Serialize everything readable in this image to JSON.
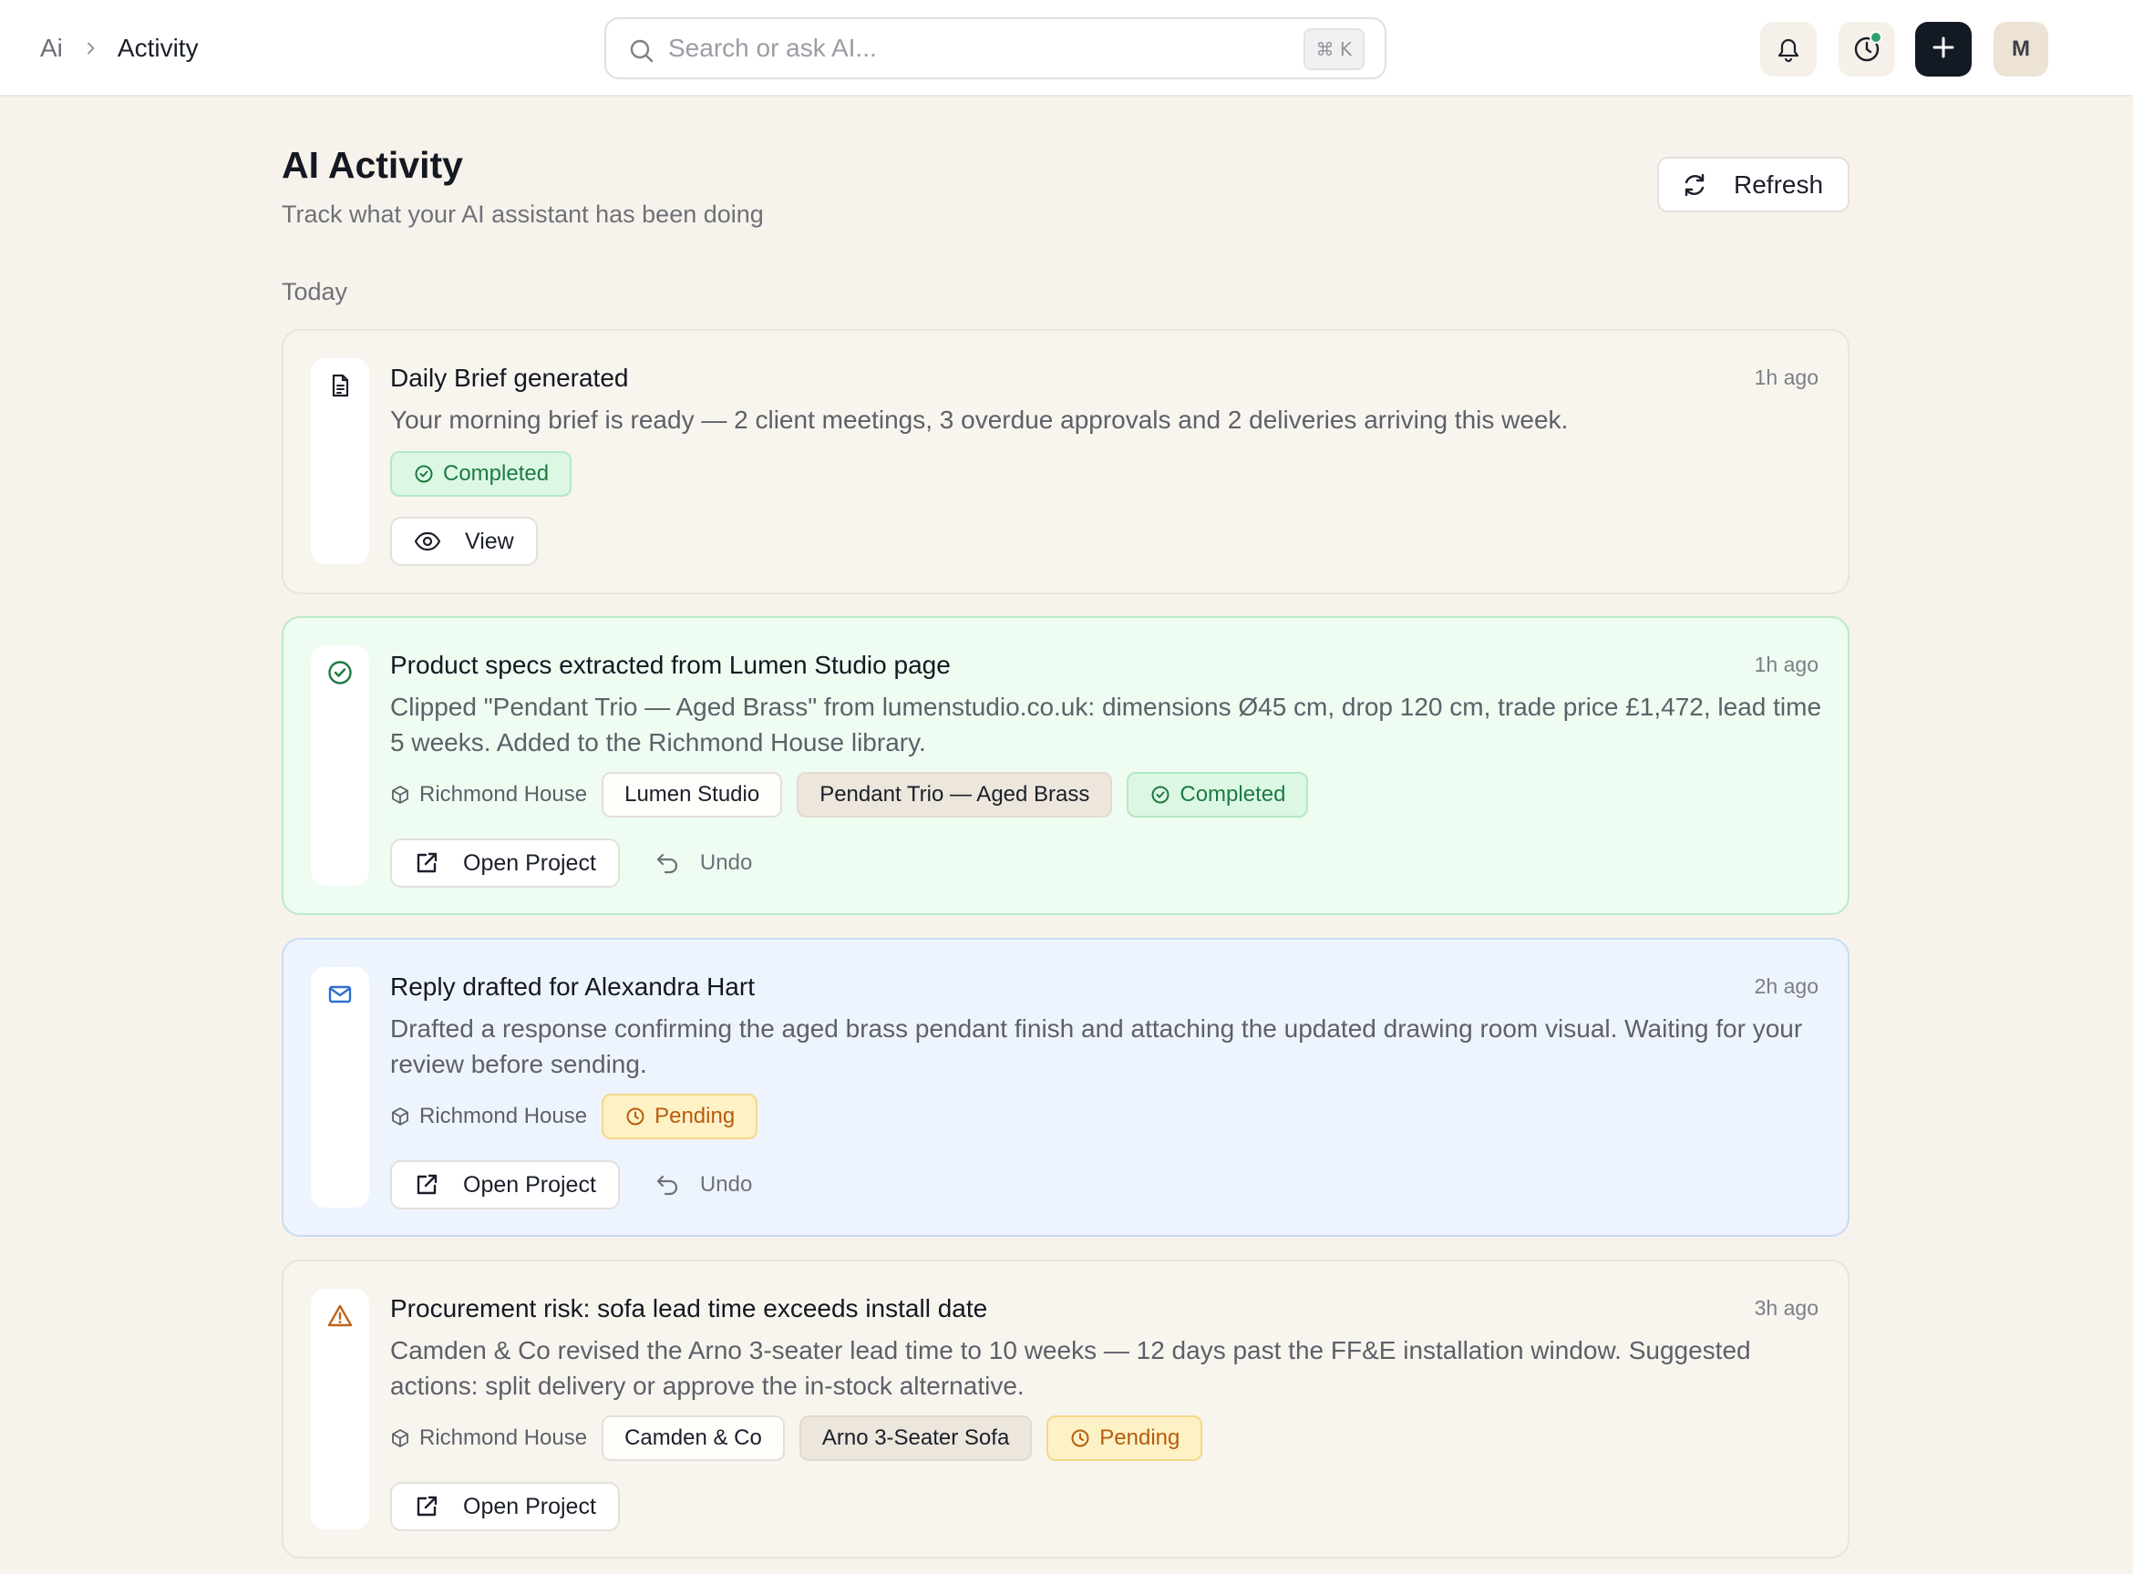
{
  "breadcrumb": {
    "root": "Ai",
    "current": "Activity"
  },
  "search": {
    "placeholder": "Search or ask AI...",
    "shortcut": "⌘ K"
  },
  "user": {
    "avatar_initial": "M"
  },
  "page": {
    "title": "AI Activity",
    "subtitle": "Track what your AI assistant has been doing",
    "refresh_label": "Refresh",
    "section_label": "Today"
  },
  "activities": [
    {
      "icon": "document-icon",
      "title": "Daily Brief generated",
      "time": "1h ago",
      "description": "Your morning brief is ready — 2 client meetings, 3 overdue approvals and 2 deliveries arriving this week.",
      "status": "Completed",
      "action_label": "View"
    },
    {
      "icon": "check-circle-icon",
      "title": "Product specs extracted from Lumen Studio page",
      "time": "1h ago",
      "description": "Clipped \"Pendant Trio — Aged Brass\" from lumenstudio.co.uk: dimensions Ø45 cm, drop 120 cm, trade price £1,472, lead time 5 weeks. Added to the Richmond House library.",
      "project": "Richmond House",
      "chips": [
        "Lumen Studio",
        "Pendant Trio — Aged Brass"
      ],
      "status": "Completed",
      "action_label": "Open Project",
      "undo_label": "Undo"
    },
    {
      "icon": "mail-icon",
      "title": "Reply drafted for Alexandra Hart",
      "time": "2h ago",
      "description": "Drafted a response confirming the aged brass pendant finish and attaching the updated drawing room visual. Waiting for your review before sending.",
      "project": "Richmond House",
      "status": "Pending",
      "action_label": "Open Project",
      "undo_label": "Undo"
    },
    {
      "icon": "warning-icon",
      "title": "Procurement risk: sofa lead time exceeds install date",
      "time": "3h ago",
      "description": "Camden & Co revised the Arno 3-seater lead time to 10 weeks — 12 days past the FF&E installation window. Suggested actions: split delivery or approve the in-stock alternative.",
      "project": "Richmond House",
      "chips": [
        "Camden & Co",
        "Arno 3-Seater Sofa"
      ],
      "status": "Pending",
      "action_label": "Open Project"
    }
  ],
  "colors": {
    "background": "#f7f3ec",
    "completed": "#1d7a43",
    "pending": "#b75c0e",
    "info_icon": "#2f6fd1",
    "warning_icon": "#c2621a",
    "primary_button": "#141a24"
  }
}
